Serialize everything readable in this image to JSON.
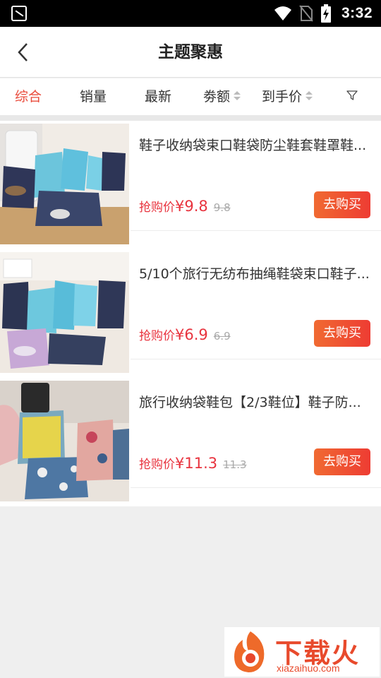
{
  "status_bar": {
    "time": "3:32"
  },
  "header": {
    "title": "主题聚惠"
  },
  "sort_bar": {
    "items": [
      {
        "label": "综合",
        "active": true
      },
      {
        "label": "销量",
        "active": false
      },
      {
        "label": "最新",
        "active": false
      },
      {
        "label": "劵额",
        "active": false
      },
      {
        "label": "到手价",
        "active": false
      }
    ]
  },
  "products": [
    {
      "name": "鞋子收纳袋束口鞋袋防尘鞋套鞋罩鞋...",
      "price_label": "抢购价",
      "price": "¥9.8",
      "orig_price": "9.8",
      "buy_label": "去购买"
    },
    {
      "name": "5/10个旅行无纺布抽绳鞋袋束口鞋子...",
      "price_label": "抢购价",
      "price": "¥6.9",
      "orig_price": "6.9",
      "buy_label": "去购买"
    },
    {
      "name": "旅行收纳袋鞋包【2/3鞋位】鞋子防...",
      "price_label": "抢购价",
      "price": "¥11.3",
      "orig_price": "11.3",
      "buy_label": "去购买"
    }
  ],
  "watermark": {
    "text": "下载火",
    "url": "xiazaihuo.com"
  },
  "colors": {
    "accent": "#e94b3c",
    "price": "#e8333e",
    "button_start": "#f06a32",
    "button_end": "#ee3c33"
  }
}
